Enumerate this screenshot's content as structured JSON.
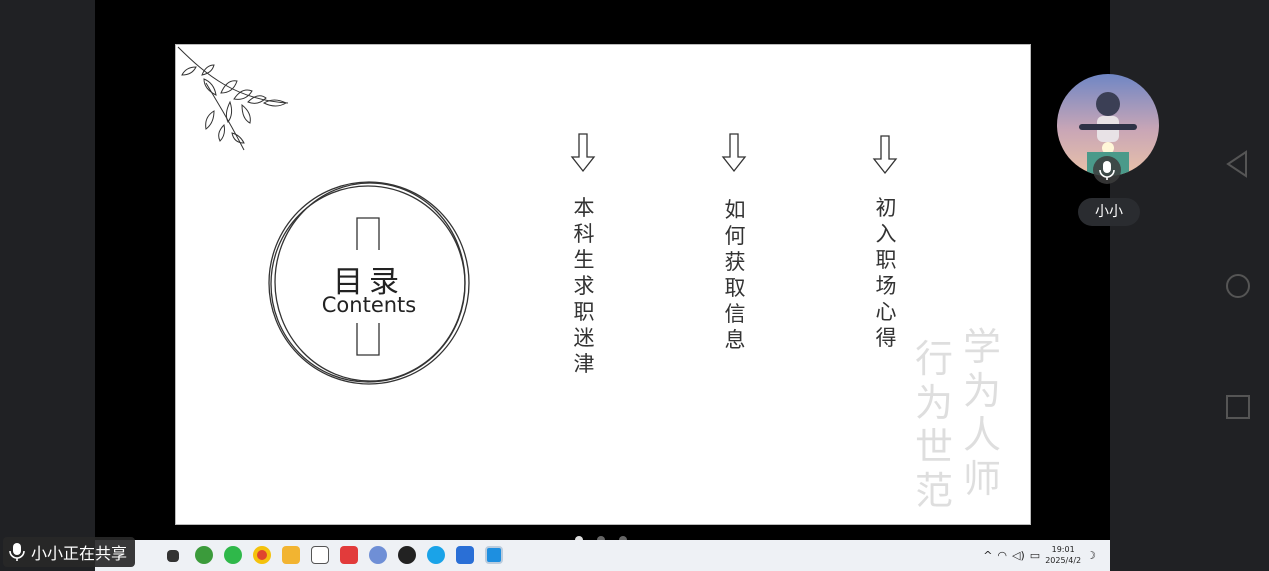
{
  "slide": {
    "toc_title": "目录",
    "toc_subtitle": "Contents",
    "items": [
      {
        "label": "本科生求职迷津"
      },
      {
        "label": "如何获取信息"
      },
      {
        "label": "初入职场心得"
      }
    ],
    "seal": {
      "col1": "学为人师",
      "col2": "行为世范"
    }
  },
  "participant": {
    "name": "小小"
  },
  "share_status": "小小正在共享",
  "pagination": {
    "total": 3,
    "active": 1
  },
  "taskbar": {
    "time": "19:01",
    "date": "2025/4/2"
  },
  "colors": {
    "background": "#202124",
    "slide_bg": "#ffffff",
    "text": "#333333"
  }
}
